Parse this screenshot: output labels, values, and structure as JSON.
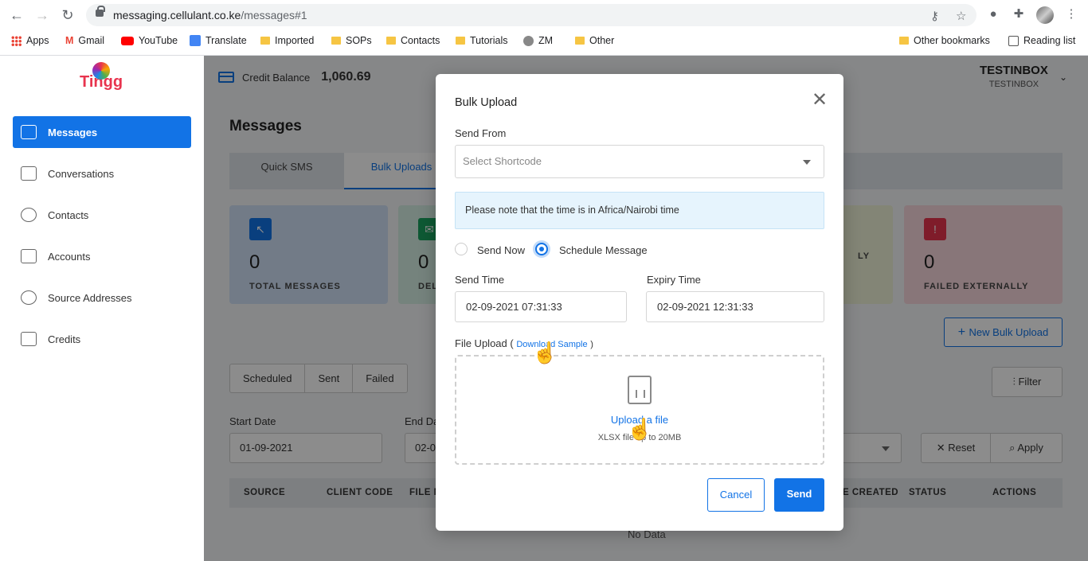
{
  "browser": {
    "url_host": "messaging.cellulant.co.ke",
    "url_path": "/messages#1",
    "bookmarks": [
      "Apps",
      "Gmail",
      "YouTube",
      "Translate",
      "Imported",
      "SOPs",
      "Contacts",
      "Tutorials",
      "ZM",
      "Other"
    ],
    "other_bookmarks": "Other bookmarks",
    "reading_list": "Reading list"
  },
  "app": {
    "logo": "Tingg",
    "credit_label": "Credit Balance",
    "credit_value": "1,060.69",
    "user_name": "TESTINBOX",
    "user_sub": "TESTINBOX"
  },
  "sidebar": {
    "items": [
      {
        "label": "Messages"
      },
      {
        "label": "Conversations"
      },
      {
        "label": "Contacts"
      },
      {
        "label": "Accounts"
      },
      {
        "label": "Source Addresses"
      },
      {
        "label": "Credits"
      }
    ]
  },
  "main": {
    "title": "Messages",
    "tabs": [
      "Quick SMS",
      "Bulk Uploads"
    ],
    "stats": [
      {
        "value": "0",
        "label": "TOTAL MESSAGES"
      },
      {
        "value": "0",
        "label": "DEL"
      },
      {
        "value": "",
        "label": "LY"
      },
      {
        "value": "0",
        "label": "FAILED EXTERNALLY"
      }
    ],
    "new_bulk_upload": "New Bulk Upload",
    "filter": "Filter",
    "segments": [
      "Scheduled",
      "Sent",
      "Failed"
    ],
    "start_date_label": "Start Date",
    "start_date_value": "01-09-2021",
    "end_date_label": "End Da",
    "end_date_value": "02-0",
    "reset": "Reset",
    "apply": "Apply",
    "columns": [
      "SOURCE",
      "CLIENT CODE",
      "FILE N",
      "E CREATED",
      "STATUS",
      "ACTIONS"
    ],
    "no_data": "No Data"
  },
  "modal": {
    "title": "Bulk Upload",
    "send_from_label": "Send From",
    "shortcode_placeholder": "Select Shortcode",
    "note": "Please note that the time is in Africa/Nairobi time",
    "radio_send_now": "Send Now",
    "radio_schedule": "Schedule Message",
    "send_time_label": "Send Time",
    "send_time_value": "02-09-2021 07:31:33",
    "expiry_time_label": "Expiry Time",
    "expiry_time_value": "02-09-2021  12:31:33",
    "file_upload_label": "File Upload (",
    "download_sample": "Download Sample",
    "file_upload_close": ")",
    "upload_link": "Upload a file",
    "upload_hint": "XLSX file up to 20MB",
    "cancel": "Cancel",
    "send": "Send"
  },
  "colors": {
    "primary": "#1273e6",
    "stat_blue": "#cfe0f6",
    "stat_green": "#d6efe3",
    "stat_yellow": "#eef3d8",
    "stat_red": "#f7d8dc"
  }
}
